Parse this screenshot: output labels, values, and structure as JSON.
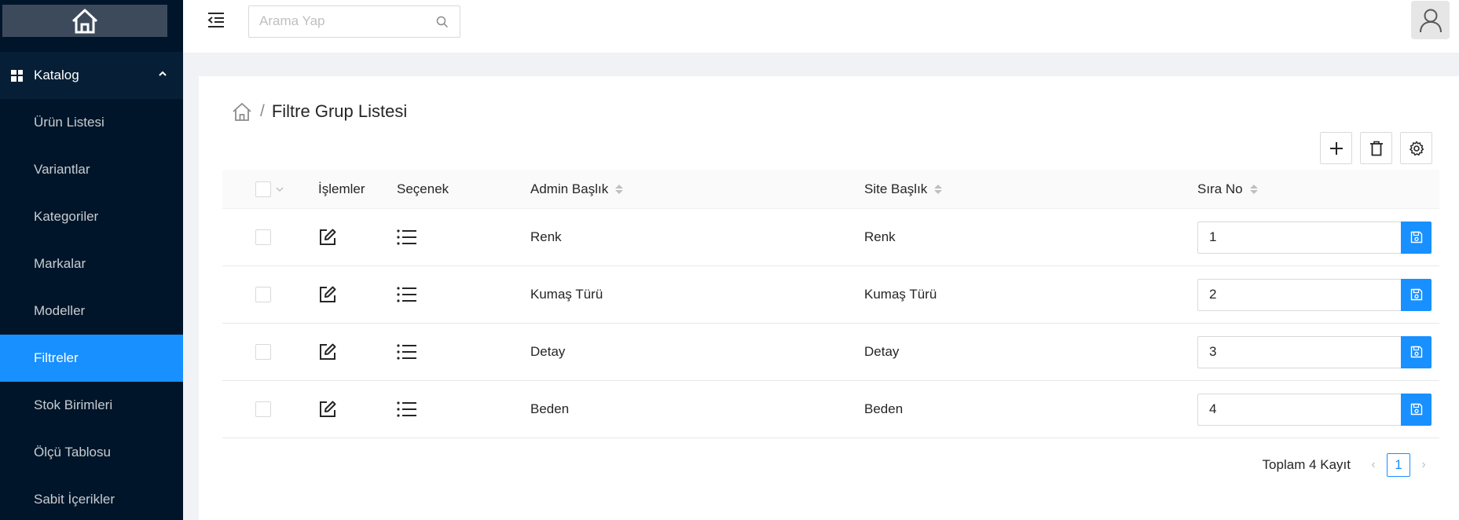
{
  "sidebar": {
    "logo_icon": "home-icon",
    "section": {
      "label": "Katalog",
      "icon": "appstore-icon",
      "expanded": true
    },
    "items": [
      {
        "label": "Ürün Listesi"
      },
      {
        "label": "Variantlar"
      },
      {
        "label": "Kategoriler"
      },
      {
        "label": "Markalar"
      },
      {
        "label": "Modeller"
      },
      {
        "label": "Filtreler",
        "active": true
      },
      {
        "label": "Stok Birimleri"
      },
      {
        "label": "Ölçü Tablosu"
      },
      {
        "label": "Sabit İçerikler"
      }
    ]
  },
  "header": {
    "search": {
      "placeholder": "Arama Yap",
      "value": ""
    }
  },
  "page": {
    "breadcrumb_separator": "/",
    "title": "Filtre Grup Listesi"
  },
  "table": {
    "columns": {
      "islemler": "İşlemler",
      "secenek": "Seçenek",
      "admin_baslik": "Admin Başlık",
      "site_baslik": "Site Başlık",
      "sira_no": "Sıra No"
    },
    "rows": [
      {
        "admin": "Renk",
        "site": "Renk",
        "sira": "1"
      },
      {
        "admin": "Kumaş Türü",
        "site": "Kumaş Türü",
        "sira": "2"
      },
      {
        "admin": "Detay",
        "site": "Detay",
        "sira": "3"
      },
      {
        "admin": "Beden",
        "site": "Beden",
        "sira": "4"
      }
    ]
  },
  "pagination": {
    "total_text": "Toplam 4 Kayıt",
    "current_page": "1",
    "prev": "‹",
    "next": "›"
  },
  "colors": {
    "accent": "#1890ff",
    "sidebar_bg": "#001529"
  }
}
